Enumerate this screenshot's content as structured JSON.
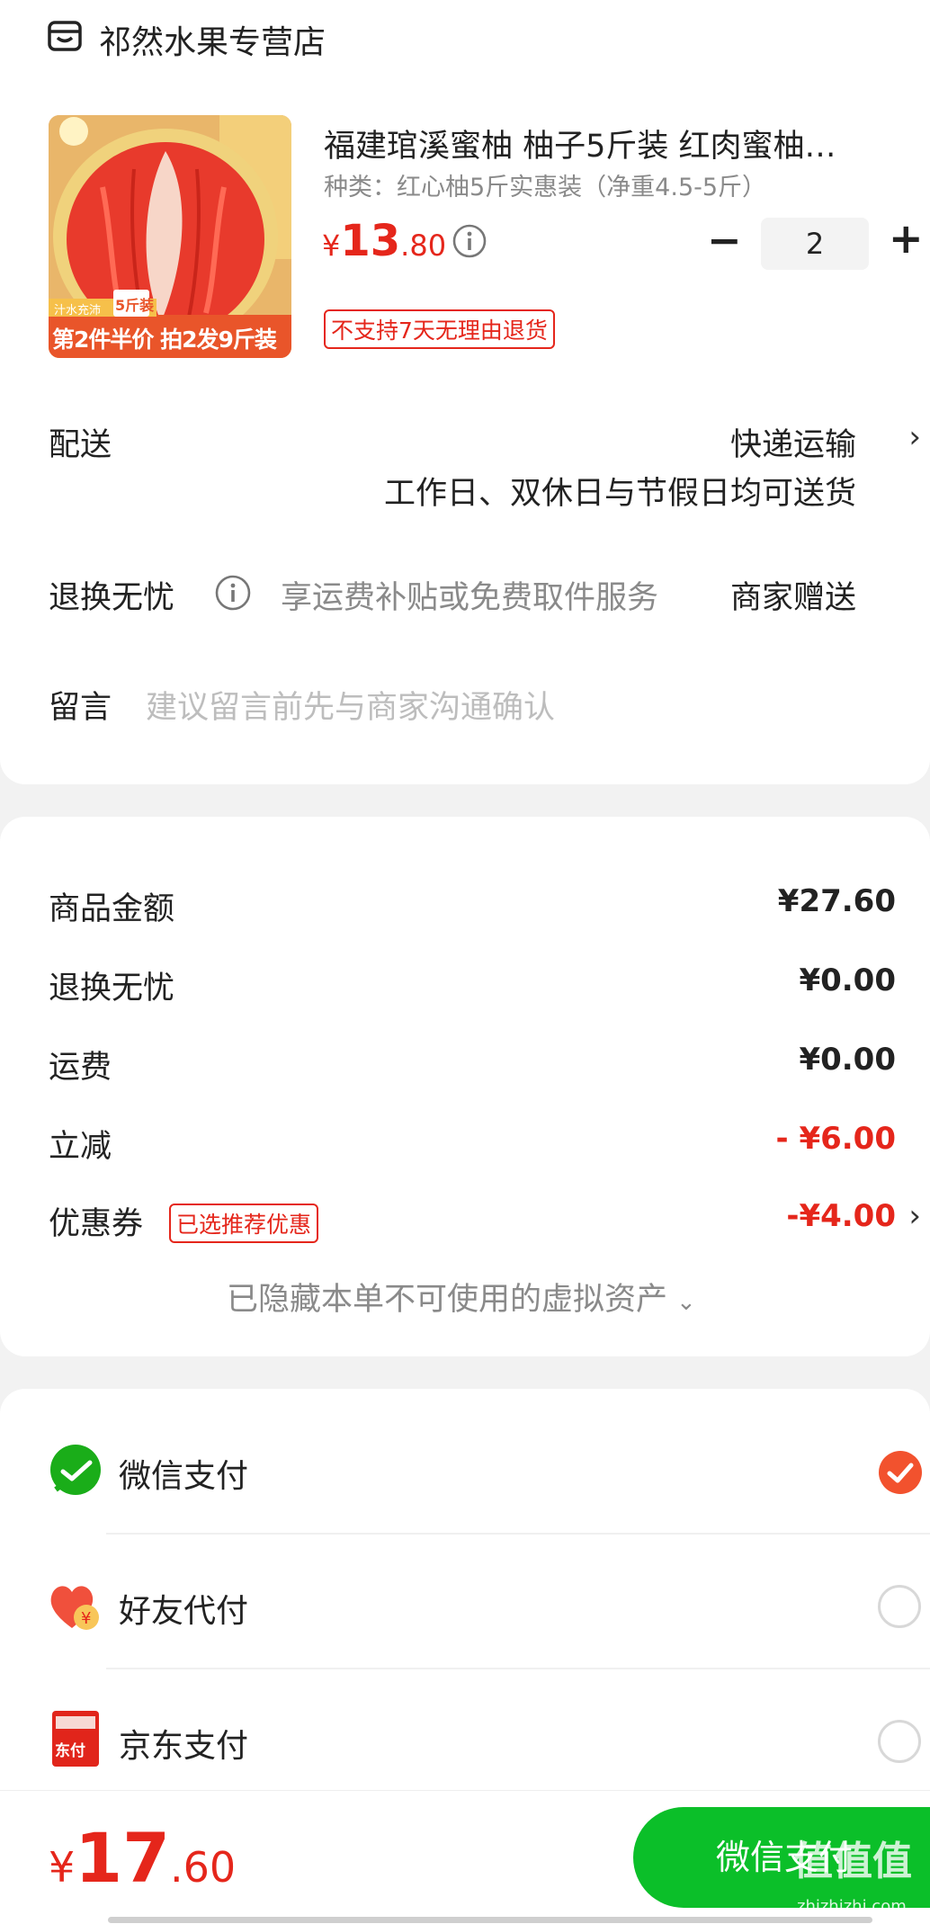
{
  "store": {
    "name": "祁然水果专营店",
    "icon": "shop-icon"
  },
  "product": {
    "title": "福建琯溪蜜柚 柚子5斤装 红肉蜜柚…",
    "spec": "种类：红心柚5斤实惠装（净重4.5-5斤）",
    "currency": "¥",
    "price_int": "13",
    "price_dec": ".80",
    "quantity": "2",
    "minus": "−",
    "plus": "+",
    "return_tag": "不支持7天无理由退货",
    "image": {
      "badge_top": "汁水充沛",
      "badge_weight": "5斤装",
      "banner": "第2件半价 拍2发9斤装"
    }
  },
  "delivery": {
    "label": "配送",
    "method": "快递运输",
    "note": "工作日、双休日与节假日均可送货"
  },
  "return_service": {
    "label": "退换无忧",
    "desc": "享运费补贴或免费取件服务",
    "value": "商家赠送"
  },
  "message": {
    "label": "留言",
    "placeholder": "建议留言前先与商家沟通确认"
  },
  "summary": {
    "goods_label": "商品金额",
    "goods_value": "¥27.60",
    "return_label": "退换无忧",
    "return_value": "¥0.00",
    "shipping_label": "运费",
    "shipping_value": "¥0.00",
    "discount_label": "立减",
    "discount_value": "- ¥6.00",
    "coupon_label": "优惠券",
    "coupon_tag": "已选推荐优惠",
    "coupon_value": "-¥4.00",
    "hidden_note": "已隐藏本单不可使用的虚拟资产"
  },
  "payment": {
    "methods": [
      {
        "label": "微信支付",
        "icon": "wechat-pay-icon",
        "selected": true
      },
      {
        "label": "好友代付",
        "icon": "friend-pay-icon",
        "selected": false
      },
      {
        "label": "京东支付",
        "icon": "jd-pay-icon",
        "selected": false
      }
    ],
    "jd_icon_text": "东付"
  },
  "footer": {
    "currency": "¥",
    "total_int": "17",
    "total_dec": ".60",
    "pay_button": "微信支付",
    "watermark": "值值值",
    "watermark_url": "zhizhizhi.com"
  },
  "colors": {
    "accent_red": "#e5261b",
    "wechat_green": "#1aad19",
    "pay_button_green": "#0bbf29"
  }
}
